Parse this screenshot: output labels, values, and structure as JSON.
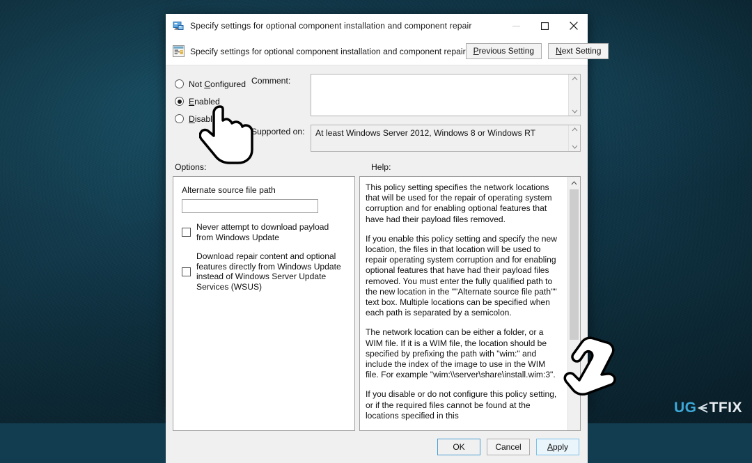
{
  "window": {
    "title": "Specify settings for optional component installation and component repair",
    "title_icon": "policy-computer-icon",
    "minimize_label": "Minimize",
    "maximize_label": "Maximize",
    "close_label": "Close"
  },
  "header": {
    "icon": "group-policy-icon",
    "title": "Specify settings for optional component installation and component repair",
    "previous_setting_label": "Previous Setting",
    "previous_setting_accel": "P",
    "next_setting_label": "Next Setting",
    "next_setting_accel": "N"
  },
  "state": {
    "options": [
      {
        "label": "Not Configured",
        "accel": "C",
        "pre": "Not ",
        "post": "onfigured",
        "selected": false
      },
      {
        "label": "Enabled",
        "accel": "E",
        "pre": "",
        "post": "nabled",
        "selected": true
      },
      {
        "label": "Disabled",
        "accel": "D",
        "pre": "",
        "post": "isabled",
        "selected": false
      }
    ]
  },
  "fields": {
    "comment_label": "Comment:",
    "comment_value": "",
    "supported_label": "Supported on:",
    "supported_value": "At least Windows Server 2012, Windows 8 or Windows RT"
  },
  "panels": {
    "options_label": "Options:",
    "help_label": "Help:"
  },
  "options": {
    "alt_path_label": "Alternate source file path",
    "alt_path_value": "",
    "alt_path_placeholder": "",
    "checkboxes": [
      {
        "label": "Never attempt to download payload from Windows Update",
        "checked": false
      },
      {
        "label": "Download repair content and optional features directly from Windows Update instead of Windows Server Update Services (WSUS)",
        "checked": false
      }
    ]
  },
  "help": {
    "paragraphs": [
      "This policy setting specifies the network locations that will be used for the repair of operating system corruption and for enabling optional features that have had their payload files removed.",
      "If you enable this policy setting and specify the new location, the files in that location will be used to repair operating system corruption and for enabling optional features that have had their payload files removed. You must enter the fully qualified path to the new location in the \"\"Alternate source file path\"\" text box. Multiple locations can be specified when each path is separated by a semicolon.",
      "The network location can be either a folder, or a WIM file. If it is a WIM file, the location should be specified by prefixing the path with \"wim:\" and include the index of the image to use in the WIM file. For example \"wim:\\\\server\\share\\install.wim:3\".",
      "If you disable or do not configure this policy setting, or if the required files cannot be found at the locations specified in this"
    ]
  },
  "footer": {
    "ok_label": "OK",
    "cancel_label": "Cancel",
    "apply_label": "Apply",
    "apply_accel": "A"
  },
  "watermark": {
    "part1": "UG",
    "part2": "E",
    "part3": "TFIX",
    "color1": "#3da8d8",
    "color3": "#e8eef2"
  },
  "cursors": [
    {
      "name": "hand-cursor-radio"
    },
    {
      "name": "hand-cursor-apply"
    }
  ]
}
